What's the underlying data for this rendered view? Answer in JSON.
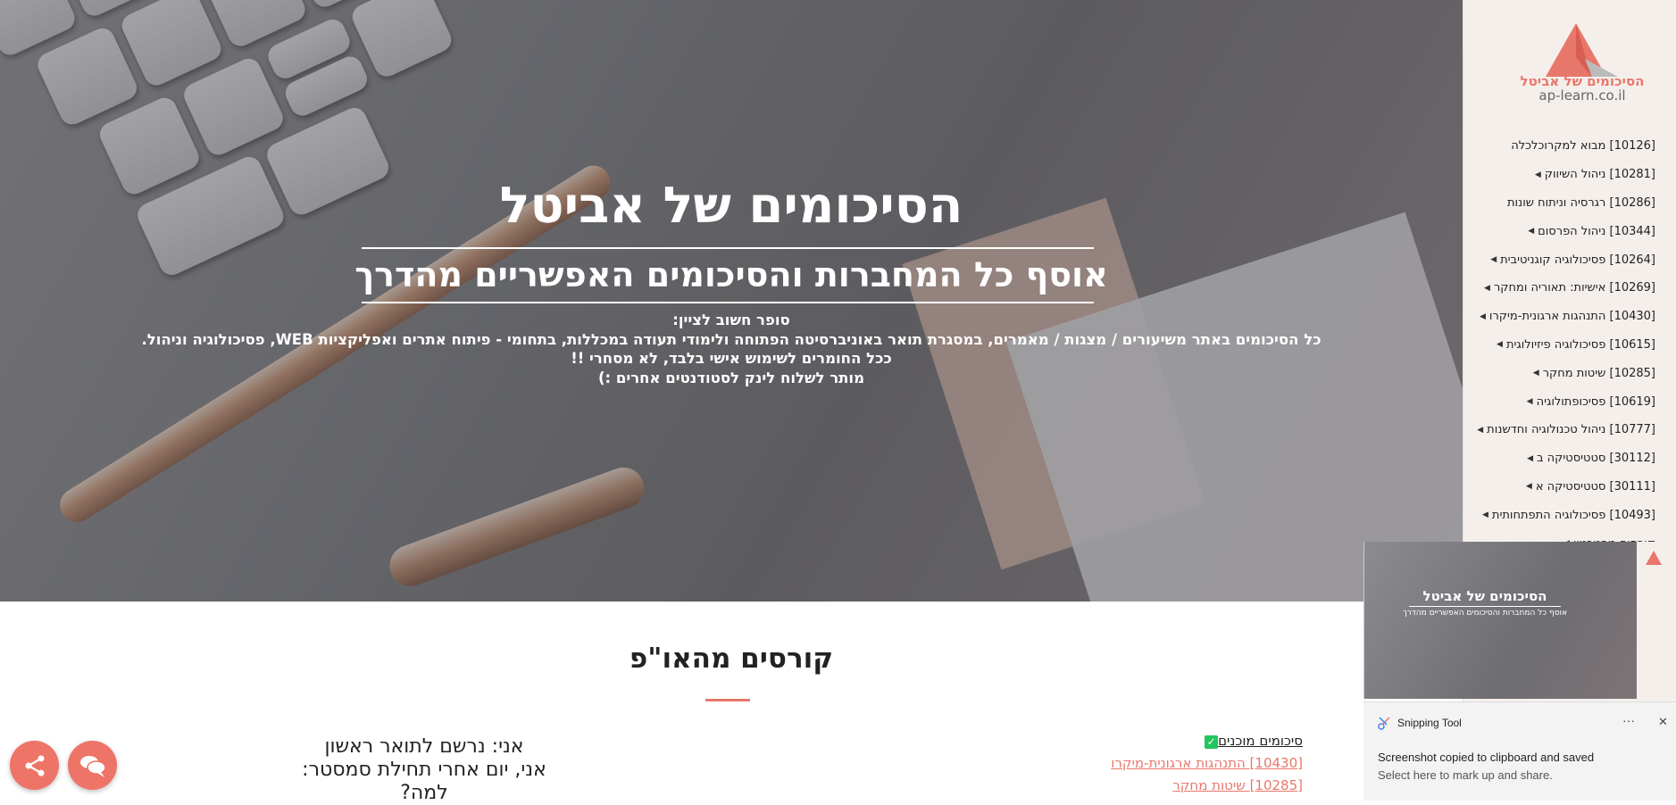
{
  "hero": {
    "title": "הסיכומים של אביטל",
    "subtitle": "אוסף כל המחברות והסיכומים האפשריים מהדרך",
    "notes": [
      "סופר חשוב לציין:",
      "כל הסיכומים באתר משיעורים / מצגות / מאמרים, במסגרת תואר באוניברסיטה הפתוחה ולימודי תעודה במכללות, בתחומי - פיתוח אתרים ואפליקציות WEB, פסיכולוגיה וניהול.",
      "ככל החומרים לשימוש אישי בלבד, לא מסחרי !!",
      "מותר לשלוח לינק לסטודנטים אחרים :)"
    ]
  },
  "sidebar": {
    "logo_title": "הסיכומים של אביטל",
    "logo_url": "ap-learn.co.il",
    "items": [
      {
        "label": "[10126] מבוא למקרוכלכלה",
        "arrow": false
      },
      {
        "label": "[10281] ניהול השיווק",
        "arrow": true
      },
      {
        "label": "[10286] רגרסיה וניתוח שונות",
        "arrow": false
      },
      {
        "label": "[10344] ניהול הפרסום",
        "arrow": true
      },
      {
        "label": "[10264] פסיכולוגיה קוגניטיבית",
        "arrow": true
      },
      {
        "label": "[10269] אישיות: תאוריה ומחקר",
        "arrow": true
      },
      {
        "label": "[10430] התנהגות ארגונית-מיקרו",
        "arrow": true
      },
      {
        "label": "[10615] פסיכולוגיה פיזיולוגית",
        "arrow": true
      },
      {
        "label": "[10285] שיטות מחקר",
        "arrow": true
      },
      {
        "label": "[10619] פסיכופתולוגיה",
        "arrow": true
      },
      {
        "label": "[10777] ניהול טכנולוגיה וחדשנות",
        "arrow": true
      },
      {
        "label": "[30112] סטטיסטיקה ב",
        "arrow": true
      },
      {
        "label": "[30111] סטטיסטיקה א",
        "arrow": true
      },
      {
        "label": "[10493] פסיכולוגיה התפתחותית",
        "arrow": true
      },
      {
        "label": "קורסים מהטכניון",
        "arrow": true
      }
    ]
  },
  "section": {
    "title": "קורסים מהאו\"פ",
    "ready_label": "סיכומים מוכנים",
    "ready_links": [
      "[10430] התנהגות ארגונית-מיקרו",
      "[10285] שיטות מחקר"
    ],
    "me_lines": [
      "אני: נרשם לתואר ראשון",
      "אני, יום אחרי תחילת סמסטר:",
      "למה?"
    ]
  },
  "thumbnail": {
    "title": "הסיכומים של אביטל",
    "subtitle": "אוסף כל המחברות והסיכומים האפשריים מהדרך"
  },
  "toast": {
    "app_name": "Snipping Tool",
    "more": "···",
    "close": "✕",
    "message": "Screenshot copied to clipboard and saved",
    "hint": "Select here to mark up and share."
  },
  "colors": {
    "accent": "#ee7468",
    "link": "#e8776b",
    "sidebar_bg": "#f5efec",
    "check": "#22c55e"
  },
  "icons": {
    "share": "share-icon",
    "chat": "chat-icon",
    "check": "check-icon",
    "snip": "snipping-tool-icon"
  }
}
